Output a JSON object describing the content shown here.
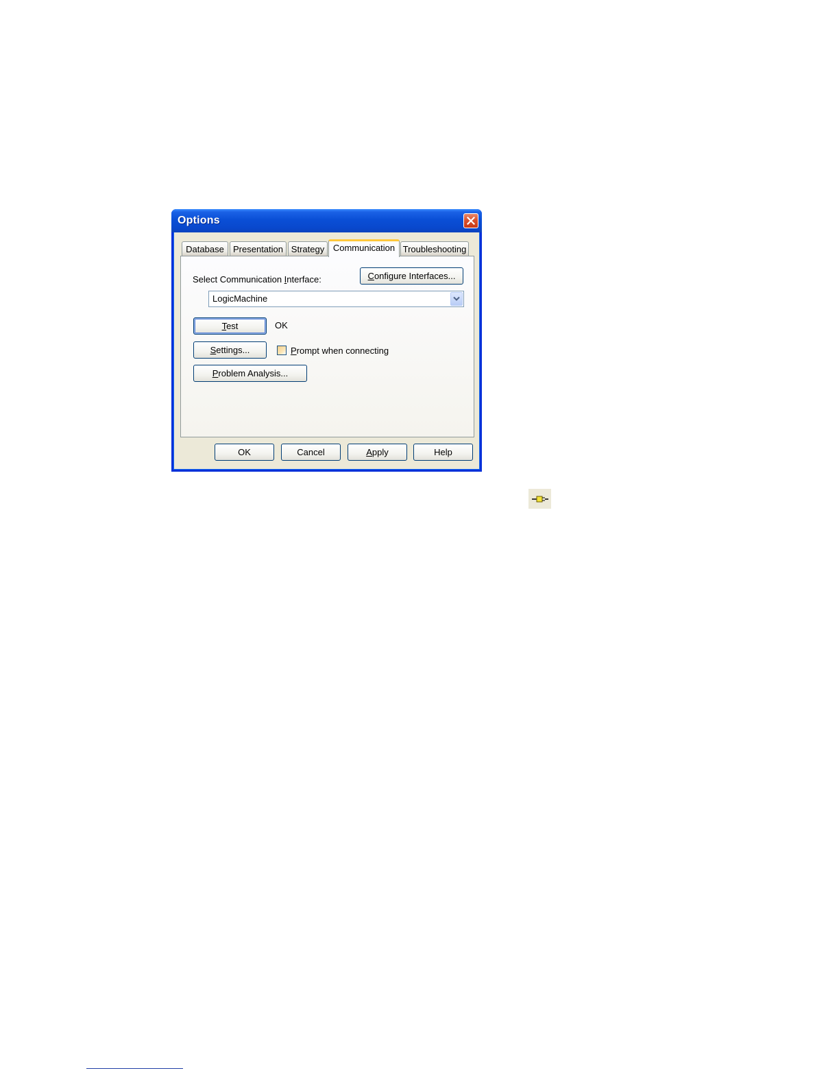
{
  "dialog": {
    "title": "Options",
    "tabs": [
      {
        "label": "Database",
        "active": false
      },
      {
        "label": "Presentation",
        "active": false
      },
      {
        "label": "Strategy",
        "active": false
      },
      {
        "label": "Communication",
        "active": true
      },
      {
        "label": "Troubleshooting",
        "active": false
      }
    ],
    "communication": {
      "select_label": "Select Communication Interface:",
      "configure_button": "Configure Interfaces...",
      "interface_value": "LogicMachine",
      "test_button": "Test",
      "test_status": "OK",
      "settings_button": "Settings...",
      "prompt_checkbox_label": "Prompt when connecting",
      "prompt_checked": false,
      "problem_analysis_button": "Problem Analysis..."
    },
    "footer": {
      "ok": "OK",
      "cancel": "Cancel",
      "apply": "Apply",
      "help": "Help"
    }
  },
  "icons": {
    "close": "close-icon",
    "dropdown": "chevron-down-icon",
    "toolbar": "connection-plug-icon"
  },
  "colors": {
    "titlebar": "#0a4fd6",
    "dialog_bg": "#ece9d8",
    "active_tab_accent": "#ffc83c",
    "close_button": "#d9512d"
  }
}
